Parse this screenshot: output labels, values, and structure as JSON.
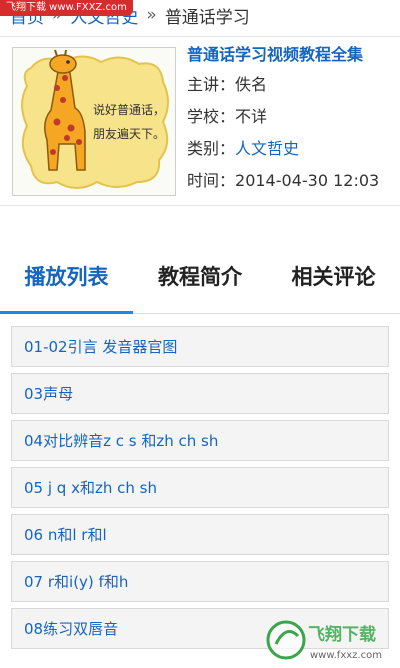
{
  "watermark": {
    "top": "飞翔下载 www.FXXZ.com",
    "logo": "飞翔下载",
    "url": "www.fxxz.com"
  },
  "breadcrumb": {
    "home": "首页",
    "category": "人文哲史",
    "current": "普通话学习",
    "separator": "»"
  },
  "course": {
    "title": "普通话学习视频教程全集",
    "speaker_label": "主讲：",
    "speaker": "佚名",
    "school_label": "学校：",
    "school": "不详",
    "category_label": "类别：",
    "category": "人文哲史",
    "time_label": "时间：",
    "time": "2014-04-30 12:03",
    "cover_text": [
      "说好普通话，",
      "朋友遍天下。"
    ]
  },
  "tabs": [
    {
      "label": "播放列表",
      "active": true
    },
    {
      "label": "教程简介",
      "active": false
    },
    {
      "label": "相关评论",
      "active": false
    }
  ],
  "playlist": [
    "01-02引言 发音器官图",
    "03声母",
    "04对比辨音z c s 和zh ch sh",
    "05 j q x和zh ch sh",
    "06 n和l r和l",
    "07 r和i(y) f和h",
    "08练习双唇音"
  ],
  "colors": {
    "link": "#1565c0",
    "tab_underline": "#1e88e5",
    "watermark": "#d62c2c"
  }
}
